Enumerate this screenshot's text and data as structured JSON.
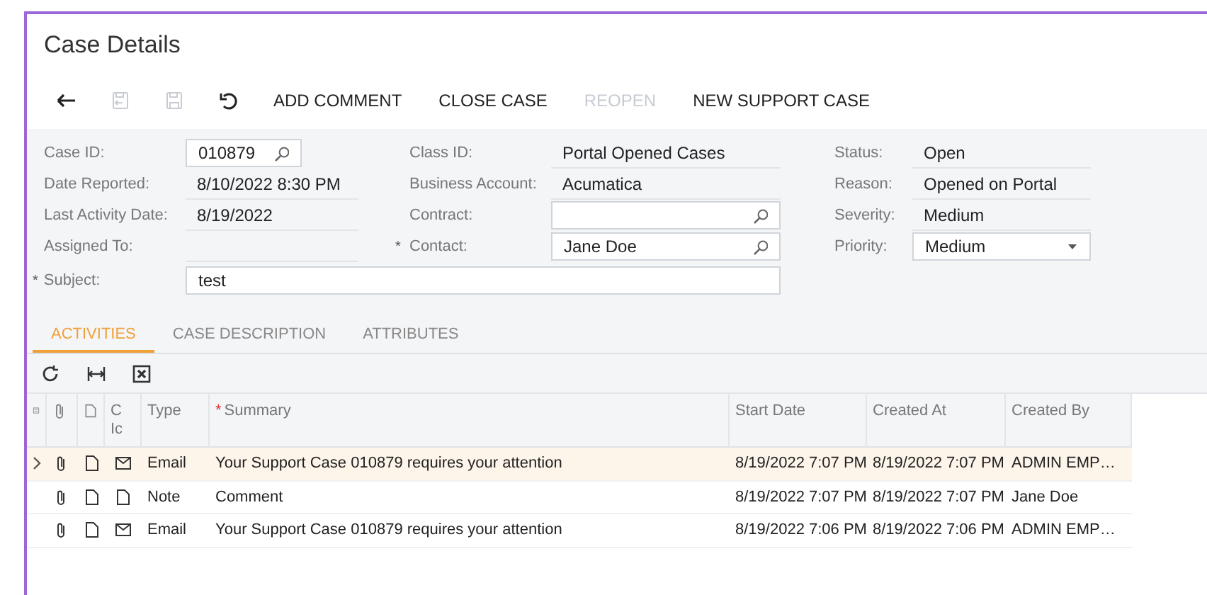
{
  "window": {
    "title": "Case Details"
  },
  "toolbar": [
    {
      "kind": "back",
      "disabled": false
    },
    {
      "kind": "save-close",
      "disabled": true
    },
    {
      "kind": "save",
      "disabled": true
    },
    {
      "kind": "undo",
      "disabled": false
    },
    {
      "kind": "text",
      "label": "ADD COMMENT",
      "disabled": false
    },
    {
      "kind": "text",
      "label": "CLOSE CASE",
      "disabled": false
    },
    {
      "kind": "text",
      "label": "REOPEN",
      "disabled": true
    },
    {
      "kind": "text",
      "label": "NEW SUPPORT CASE",
      "disabled": false
    }
  ],
  "form": {
    "columns": [
      [
        {
          "label": "Case ID:",
          "kind": "lookup",
          "value": "010879"
        },
        {
          "label": "Date Reported:",
          "kind": "text",
          "value": "8/10/2022 8:30 PM"
        },
        {
          "label": "Last Activity Date:",
          "kind": "text",
          "value": "8/19/2022"
        },
        {
          "label": "Assigned To:",
          "kind": "text"
        }
      ],
      [
        {
          "label": "Class ID:",
          "kind": "text",
          "value": "Portal Opened Cases"
        },
        {
          "label": "Business Account:",
          "kind": "text",
          "value": "Acumatica"
        },
        {
          "label": "Contract:",
          "kind": "lookup"
        },
        {
          "label": "Contact:",
          "kind": "lookup",
          "value": "Jane Doe",
          "marker": "*"
        }
      ],
      [
        {
          "label": "Status:",
          "kind": "text",
          "value": "Open"
        },
        {
          "label": "Reason:",
          "kind": "text",
          "value": "Opened on Portal"
        },
        {
          "label": "Severity:",
          "kind": "text",
          "value": "Medium"
        },
        {
          "label": "Priority:",
          "kind": "dropdown",
          "value": "Medium"
        }
      ]
    ],
    "subject": {
      "label": "Subject:",
      "value": "test",
      "marker": "*"
    }
  },
  "tabs": [
    {
      "label": "ACTIVITIES",
      "selected": true
    },
    {
      "label": "CASE DESCRIPTION",
      "selected": false
    },
    {
      "label": "ATTRIBUTES",
      "selected": false
    }
  ],
  "grid_toolbar": [
    {
      "kind": "refresh"
    },
    {
      "kind": "fit"
    },
    {
      "kind": "excel"
    }
  ],
  "table": {
    "columns": [
      {
        "kind": "files-icon"
      },
      {
        "kind": "attach-icon"
      },
      {
        "kind": "note-icon"
      },
      {
        "kind": "text",
        "label": "C Ic"
      },
      {
        "kind": "text",
        "label": "Type"
      },
      {
        "kind": "text",
        "label": "Summary",
        "marker": "*"
      },
      {
        "kind": "text",
        "label": "Start Date"
      },
      {
        "kind": "text",
        "label": "Created At"
      },
      {
        "kind": "text",
        "label": "Created By"
      }
    ],
    "rows": [
      {
        "selected": true,
        "kind": "email",
        "type": "Email",
        "summary": "Your Support Case 010879 requires your attention",
        "start_date": "8/19/2022 7:07 PM",
        "created_at": "8/19/2022 7:07 PM",
        "created_by": "ADMIN EMP…"
      },
      {
        "selected": false,
        "kind": "note",
        "type": "Note",
        "summary": "Comment",
        "start_date": "8/19/2022 7:07 PM",
        "created_at": "8/19/2022 7:07 PM",
        "created_by": "Jane Doe"
      },
      {
        "selected": false,
        "kind": "email",
        "type": "Email",
        "summary": "Your Support Case 010879 requires your attention",
        "start_date": "8/19/2022 7:06 PM",
        "created_at": "8/19/2022 7:06 PM",
        "created_by": "ADMIN EMP…"
      }
    ]
  }
}
